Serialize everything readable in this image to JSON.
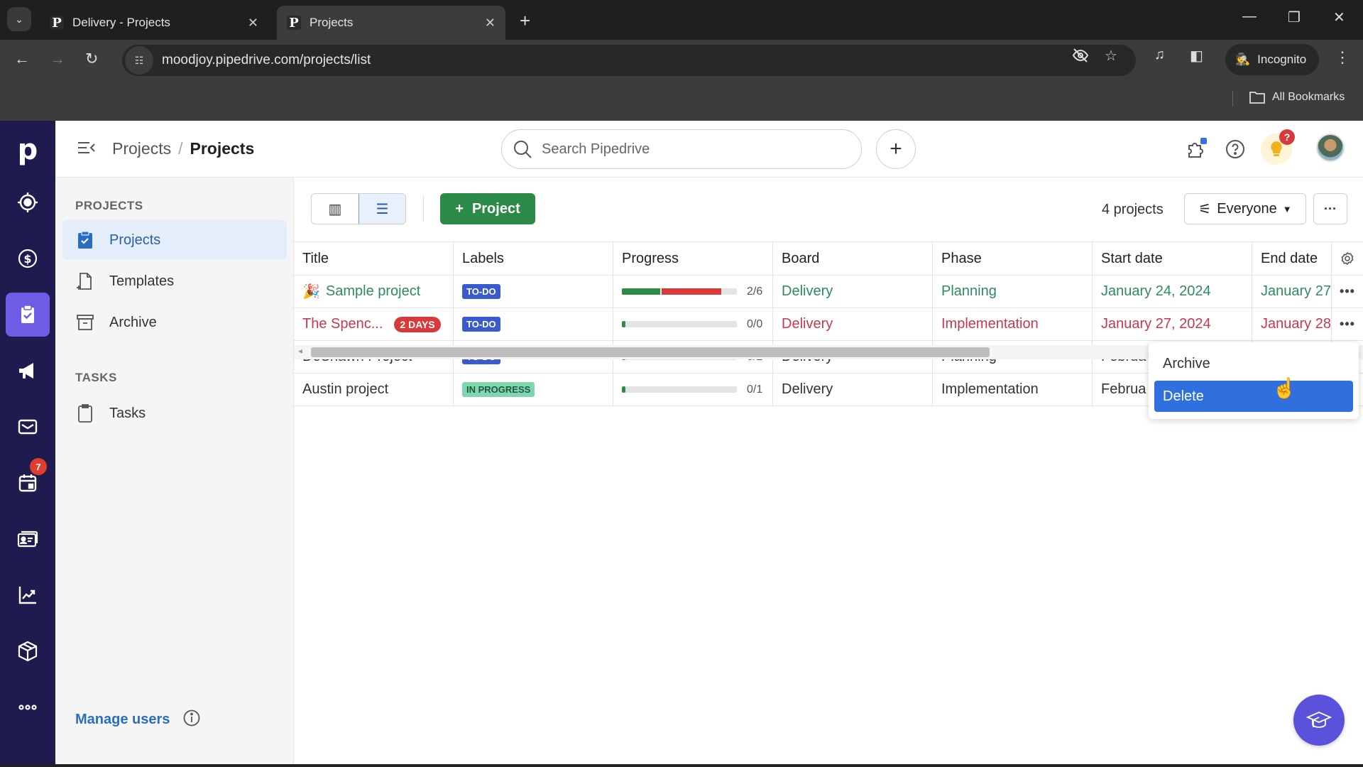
{
  "browser": {
    "tabs": [
      {
        "title": "Delivery - Projects",
        "favicon": "P",
        "active": false
      },
      {
        "title": "Projects",
        "favicon": "P",
        "active": true
      }
    ],
    "url": "moodjoy.pipedrive.com/projects/list",
    "profile_label": "Incognito",
    "bookmarks_label": "All Bookmarks"
  },
  "app": {
    "logo": "p",
    "rail": [
      {
        "name": "leads",
        "icon": "target-icon"
      },
      {
        "name": "deals",
        "icon": "dollar-icon"
      },
      {
        "name": "projects",
        "icon": "clipboard-check-icon",
        "active": true
      },
      {
        "name": "campaigns",
        "icon": "megaphone-icon"
      },
      {
        "name": "mail",
        "icon": "mail-icon"
      },
      {
        "name": "activities",
        "icon": "calendar-icon",
        "badge": "7"
      },
      {
        "name": "contacts",
        "icon": "contact-card-icon"
      },
      {
        "name": "insights",
        "icon": "chart-icon"
      },
      {
        "name": "products",
        "icon": "box-icon"
      },
      {
        "name": "more",
        "icon": "more-icon"
      }
    ],
    "breadcrumb": {
      "parent": "Projects",
      "separator": "/",
      "current": "Projects"
    },
    "search": {
      "placeholder": "Search Pipedrive",
      "value": ""
    },
    "tips_badge": "?",
    "subnav": {
      "projects_section": "PROJECTS",
      "tasks_section": "TASKS",
      "items": [
        {
          "label": "Projects",
          "active": true
        },
        {
          "label": "Templates"
        },
        {
          "label": "Archive"
        }
      ],
      "task_items": [
        {
          "label": "Tasks"
        }
      ],
      "manage_users": "Manage users"
    },
    "toolbar": {
      "add_label": "Project",
      "count_label": "4 projects",
      "filter_label": "Everyone",
      "more_label": "···"
    },
    "table": {
      "columns": [
        "Title",
        "Labels",
        "Progress",
        "Board",
        "Phase",
        "Start date",
        "End date"
      ],
      "rows": [
        {
          "title": "Sample project",
          "badge": "",
          "label": "TO-DO",
          "progress_done": 2,
          "progress_total": 6,
          "progress_text": "2/6",
          "overdue_fraction": 0.52,
          "board": "Delivery",
          "phase": "Planning",
          "start": "January 24, 2024",
          "end": "January 27",
          "status": "green"
        },
        {
          "title": "The Spenc...",
          "badge": "2 DAYS",
          "label": "TO-DO",
          "progress_done": 0,
          "progress_total": 0,
          "progress_text": "0/0",
          "board": "Delivery",
          "phase": "Implementation",
          "start": "January 27, 2024",
          "end": "January 28",
          "status": "red"
        },
        {
          "title": "DeShawn Project",
          "badge": "",
          "label": "TO-DO",
          "progress_done": 0,
          "progress_total": 2,
          "progress_text": "0/2",
          "board": "Delivery",
          "phase": "Planning",
          "start": "Februa",
          "end": "",
          "status": "normal"
        },
        {
          "title": "Austin project",
          "badge": "",
          "label": "IN PROGRESS",
          "progress_done": 0,
          "progress_total": 1,
          "progress_text": "0/1",
          "board": "Delivery",
          "phase": "Implementation",
          "start": "Februa",
          "end": "",
          "status": "normal"
        }
      ],
      "row_actions": "•••"
    },
    "context_menu": {
      "items": [
        "Archive",
        "Delete"
      ],
      "hovered": "Delete"
    }
  }
}
